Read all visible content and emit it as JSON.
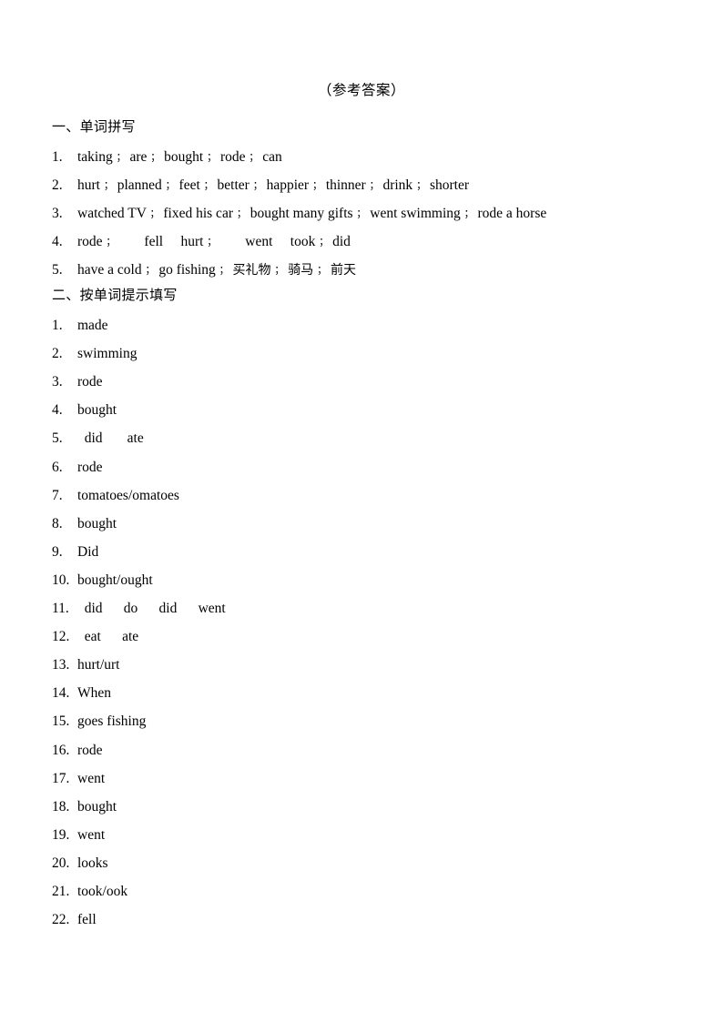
{
  "document": {
    "title": "（参考答案）",
    "background_color": "#ffffff",
    "text_color": "#000000"
  },
  "sections": [
    {
      "heading": "一、单词拼写",
      "numbering": "arabic-dot",
      "items": [
        {
          "number": "1.",
          "answer": "taking ； are ； bought ； rode ； can"
        },
        {
          "number": "2.",
          "answer": "hurt ； planned ； feet ； better ； happier ； thinner ； drink ； shorter"
        },
        {
          "number": "3.",
          "answer": "watched TV ； fixed his car ； bought many gifts ； went swimming ； rode a horse"
        },
        {
          "number": "4.",
          "answer": "rode ；        fell     hurt ；        went     took ； did"
        },
        {
          "number": "5.",
          "answer": "have a cold ； go fishing ； 买礼物 ； 骑马 ； 前天"
        }
      ]
    },
    {
      "heading": "二、按单词提示填写",
      "numbering": "arabic-dot",
      "items": [
        {
          "number": "1.",
          "answer": "made"
        },
        {
          "number": "2.",
          "answer": "swimming"
        },
        {
          "number": "3.",
          "answer": "rode"
        },
        {
          "number": "4.",
          "answer": "bought"
        },
        {
          "number": "5.",
          "answer": "  did       ate"
        },
        {
          "number": "6.",
          "answer": "rode"
        },
        {
          "number": "7.",
          "answer": "tomatoes/omatoes"
        },
        {
          "number": "8.",
          "answer": "bought"
        },
        {
          "number": "9.",
          "answer": "Did"
        },
        {
          "number": "10.",
          "answer": "bought/ought"
        },
        {
          "number": "11.",
          "answer": "  did      do      did      went"
        },
        {
          "number": "12.",
          "answer": "  eat      ate"
        },
        {
          "number": "13.",
          "answer": "hurt/urt"
        },
        {
          "number": "14.",
          "answer": "When"
        },
        {
          "number": "15.",
          "answer": "goes fishing"
        },
        {
          "number": "16.",
          "answer": "rode"
        },
        {
          "number": "17.",
          "answer": "went"
        },
        {
          "number": "18.",
          "answer": "bought"
        },
        {
          "number": "19.",
          "answer": "went"
        },
        {
          "number": "20.",
          "answer": "looks"
        },
        {
          "number": "21.",
          "answer": "took/ook"
        },
        {
          "number": "22.",
          "answer": "fell"
        }
      ]
    }
  ]
}
